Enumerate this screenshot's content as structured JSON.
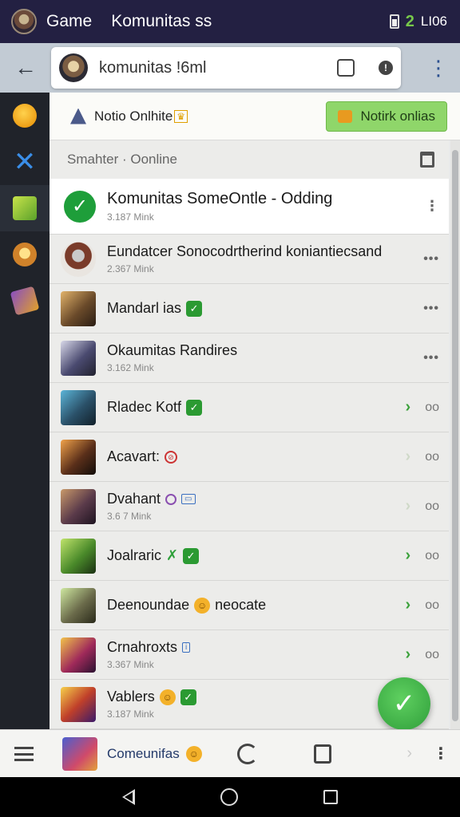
{
  "status_bar": {
    "app_name": "Game",
    "title": "Komunitas ss",
    "right_text": "LI06"
  },
  "header": {
    "search_value": "komunitas !6ml"
  },
  "online_bar": {
    "label": "Notio Onlhite",
    "button_label": "Notirk onlias"
  },
  "filter": {
    "label": "Smahter · Oonline"
  },
  "communities": [
    {
      "title": "Komunitas SomeOntle - Odding",
      "subtitle": "3.187 Mink"
    },
    {
      "title": "Eundatcer Sonocodrtherind koniantiecsand",
      "subtitle": "2.367 Mink"
    },
    {
      "title": "Mandarl ias",
      "subtitle": ""
    },
    {
      "title": "Okaumitas Randires",
      "subtitle": "3.162 Mink"
    },
    {
      "title": "Rladeс Kotf",
      "subtitle": ""
    },
    {
      "title": "Acavart:",
      "subtitle": ""
    },
    {
      "title": "Dvahant",
      "subtitle": "3.6 7 Mink"
    },
    {
      "title": "Joalraric",
      "subtitle": ""
    },
    {
      "title": "Deenoundae",
      "subtitle": "",
      "tag": "neocate"
    },
    {
      "title": "Crnahroxts",
      "subtitle": "3.367 Mink"
    },
    {
      "title": "Vablers",
      "subtitle": "3.187 Mink"
    }
  ],
  "bottom_bar": {
    "title": "Comeunifas"
  },
  "colors": {
    "status_bar_bg": "#232042",
    "accent_green": "#2b9a32",
    "sidebar_bg": "#20232a",
    "online_button": "#8fd66a"
  },
  "icons": {
    "back": "arrow-left-icon",
    "more": "vertical-dots-icon",
    "verified": "check-badge-icon",
    "fab": "check-icon"
  }
}
